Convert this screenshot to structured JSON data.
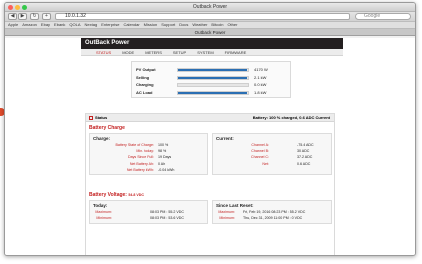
{
  "browser": {
    "window_title": "Outback Power",
    "tab_title": "Outback Power",
    "url": "10.0.1.32",
    "search_placeholder": "Google",
    "bookmarks": [
      "Apple",
      "Amazon",
      "Ebay",
      "Ebank",
      "QOLA",
      "Nextag",
      "Enterprise",
      "Calendar",
      "Mission",
      "Support",
      "Docs",
      "Weather",
      "Bitcoin",
      "Other"
    ]
  },
  "app": {
    "brand": "OutBack Power",
    "nav": [
      "STATUS",
      "MODE",
      "METERS",
      "SETUP",
      "SYSTEM",
      "FIRMWARE"
    ],
    "active_nav": "STATUS"
  },
  "summary": {
    "rows": [
      {
        "label": "PV Output",
        "value": "4170 W",
        "fill": 0.98
      },
      {
        "label": "Selling",
        "value": "2.1 kW",
        "fill": 0.98
      },
      {
        "label": "Charging",
        "value": "0.0 kW",
        "fill": 0.0
      },
      {
        "label": "AC Load",
        "value": "1.8 kW",
        "fill": 0.98
      }
    ]
  },
  "status": {
    "title": "Status",
    "summary": "Battery: 100 % charged, 0.6 ADC Current",
    "battery_charge_title": "Battery Charge",
    "charge": {
      "title": "Charge:",
      "rows": [
        {
          "label": "Battery State of Charge:",
          "value": "100 %"
        },
        {
          "label": "Min. today:",
          "value": "98 %"
        },
        {
          "label": "Days Since Full:",
          "value": "19 Days"
        },
        {
          "label": "Net Battery Ah:",
          "value": "0 Ah"
        },
        {
          "label": "Net Battery kWh:",
          "value": "-0.04 kWh"
        }
      ]
    },
    "current": {
      "title": "Current:",
      "rows": [
        {
          "label": "Channel A:",
          "value": "-75.4 ADC"
        },
        {
          "label": "Channel B:",
          "value": "30 ADC"
        },
        {
          "label": "Channel C:",
          "value": "37.2 ADC"
        },
        {
          "label": "Net:",
          "value": "0.6 ADC"
        }
      ]
    },
    "voltage_title": "Battery Voltage:",
    "voltage_value": "54.8 VDC",
    "today": {
      "title": "Today:",
      "rows": [
        {
          "label": "Maximum:",
          "value": "08:03 PM : 55.2 VDC"
        },
        {
          "label": "Minimum:",
          "value": "08:03 PM : 53.6 VDC"
        }
      ]
    },
    "since_reset": {
      "title": "Since Last Reset:",
      "rows": [
        {
          "label": "Maximum:",
          "value": "Fri, Feb 19, 2016 08:23 PM : 55.2 VDC"
        },
        {
          "label": "Minimum:",
          "value": "Thu, Dec 31, 2009 11:00 PM : 0 VDC"
        }
      ]
    }
  },
  "colors": {
    "accent": "#c31f1f",
    "bar": "#2b6fb3",
    "header": "#231f20"
  }
}
